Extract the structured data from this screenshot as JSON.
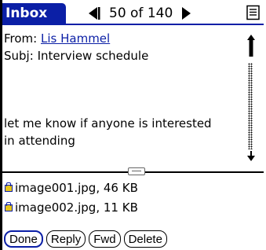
{
  "header": {
    "title": "Inbox",
    "pager_text": "50 of 140",
    "prev_icon": "triangle-left-icon",
    "next_icon": "triangle-right-icon",
    "menu_icon": "menu-icon"
  },
  "message": {
    "from_label": "From:",
    "from_name": "Lis Hammel",
    "subject_label": "Subj:",
    "subject_value": "Interview schedule",
    "body_line1": "let me know if anyone is interested",
    "body_line2": "in attending"
  },
  "attachments": [
    {
      "name": "image001.jpg",
      "size": "46 KB"
    },
    {
      "name": "image002.jpg",
      "size": "11 KB"
    }
  ],
  "buttons": {
    "done": "Done",
    "reply": "Reply",
    "fwd": "Fwd",
    "delete": "Delete"
  },
  "colors": {
    "accent": "#0b1fa6",
    "attachment_icon": "#e7c51a"
  }
}
